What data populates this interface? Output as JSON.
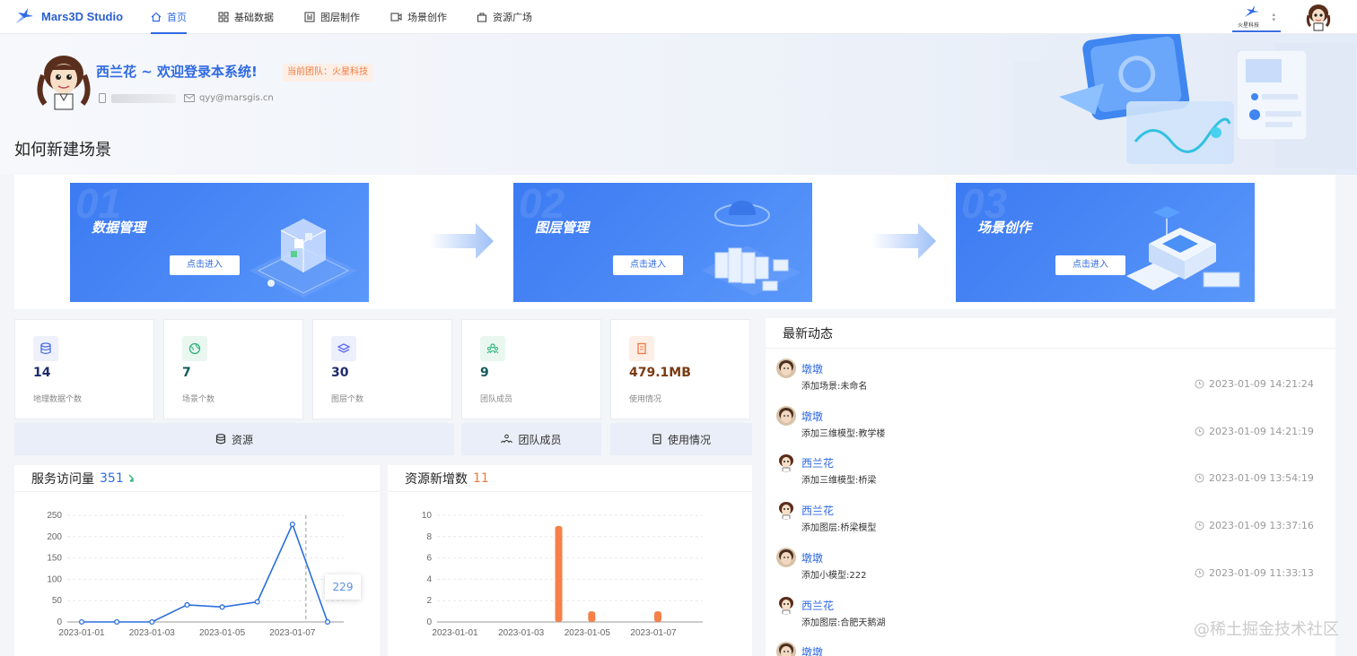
{
  "app": {
    "title": "Mars3D Studio"
  },
  "nav": {
    "items": [
      {
        "label": "首页",
        "icon": "home-icon",
        "active": true
      },
      {
        "label": "基础数据",
        "icon": "grid-icon"
      },
      {
        "label": "图层制作",
        "icon": "layers-icon"
      },
      {
        "label": "场景创作",
        "icon": "video-icon"
      },
      {
        "label": "资源广场",
        "icon": "bag-icon"
      }
    ],
    "team_logo_text": "火星科技"
  },
  "banner": {
    "welcome": "西兰花 ~ 欢迎登录本系统!",
    "team_tag": "当前团队：火星科技",
    "email": "qyy@marsgis.cn",
    "how_title": "如何新建场景"
  },
  "steps": [
    {
      "num": "01",
      "title": "数据管理",
      "button": "点击进入"
    },
    {
      "num": "02",
      "title": "图层管理",
      "button": "点击进入"
    },
    {
      "num": "03",
      "title": "场景创作",
      "button": "点击进入"
    }
  ],
  "stats": [
    {
      "value": "14",
      "label": "地理数据个数",
      "icon": "database-icon",
      "color": "#4a6ee0",
      "bg": "#eef1fc"
    },
    {
      "value": "7",
      "label": "场景个数",
      "icon": "globe-icon",
      "color": "#2fb37a",
      "bg": "#e9f7f0"
    },
    {
      "value": "30",
      "label": "图层个数",
      "icon": "layers-icon",
      "color": "#5b6ee8",
      "bg": "#eceffc"
    },
    {
      "value": "9",
      "label": "团队成员",
      "icon": "team-icon",
      "color": "#2fb37a",
      "bg": "#e9f7f0"
    },
    {
      "value": "479.1MB",
      "label": "使用情况",
      "icon": "storage-icon",
      "color": "#f07a3c",
      "bg": "#fdeee6"
    }
  ],
  "stat_footers": {
    "resources": "资源",
    "team": "团队成员",
    "usage": "使用情况"
  },
  "visits_panel": {
    "title": "服务访问量",
    "total": "351",
    "tooltip": "229"
  },
  "resources_panel": {
    "title": "资源新增数",
    "total": "11"
  },
  "activity": {
    "title": "最新动态",
    "items": [
      {
        "user": "墩墩",
        "desc": "添加场景:未命名",
        "time": "2023-01-09 14:21:24",
        "avatar": "photo"
      },
      {
        "user": "墩墩",
        "desc": "添加三维模型:教学楼",
        "time": "2023-01-09 14:21:19",
        "avatar": "photo"
      },
      {
        "user": "西兰花",
        "desc": "添加三维模型:桥梁",
        "time": "2023-01-09 13:54:19",
        "avatar": "cartoon"
      },
      {
        "user": "西兰花",
        "desc": "添加图层:桥梁模型",
        "time": "2023-01-09 13:37:16",
        "avatar": "cartoon"
      },
      {
        "user": "墩墩",
        "desc": "添加小模型:222",
        "time": "2023-01-09 11:33:13",
        "avatar": "photo"
      },
      {
        "user": "西兰花",
        "desc": "添加图层:合肥天鹅湖",
        "time": "",
        "avatar": "cartoon"
      },
      {
        "user": "墩墩",
        "desc": "",
        "time": "",
        "avatar": "photo"
      }
    ]
  },
  "watermark": "@稀土掘金技术社区",
  "colors": {
    "primary": "#2f6ae3",
    "accent": "#f07a3c",
    "line": "#2a6fdb",
    "bar": "#f5804a"
  },
  "chart_data": [
    {
      "type": "line",
      "x": [
        "2023-01-01",
        "2023-01-02",
        "2023-01-03",
        "2023-01-04",
        "2023-01-05",
        "2023-01-06",
        "2023-01-07",
        "2023-01-08"
      ],
      "xticks": [
        "2023-01-01",
        "2023-01-03",
        "2023-01-05",
        "2023-01-07"
      ],
      "values": [
        0,
        0,
        0,
        40,
        35,
        47,
        229,
        0
      ],
      "ylim": [
        0,
        250
      ],
      "yticks": [
        0,
        50,
        100,
        150,
        200,
        250
      ],
      "grid": true
    },
    {
      "type": "bar",
      "x": [
        "2023-01-01",
        "2023-01-02",
        "2023-01-03",
        "2023-01-04",
        "2023-01-05",
        "2023-01-06",
        "2023-01-07",
        "2023-01-08"
      ],
      "xticks": [
        "2023-01-01",
        "2023-01-03",
        "2023-01-05",
        "2023-01-07"
      ],
      "values": [
        0,
        0,
        0,
        9,
        1,
        0,
        1,
        0
      ],
      "ylim": [
        0,
        10
      ],
      "yticks": [
        0,
        2,
        4,
        6,
        8,
        10
      ],
      "grid": true
    }
  ]
}
